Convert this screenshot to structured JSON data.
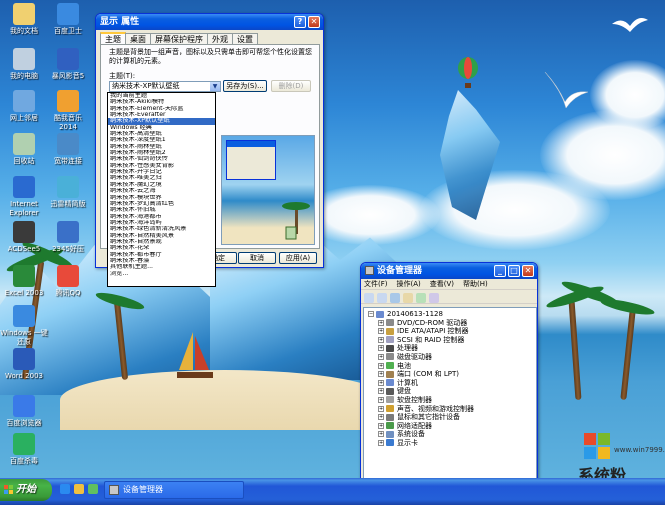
{
  "colors": {
    "xp_blue": "#0054e3",
    "start_green": "#3c9a3c",
    "selection": "#316ac5"
  },
  "desktop_icons": [
    {
      "label": "我的文档",
      "icon": "my-documents-icon"
    },
    {
      "label": "百度卫士",
      "icon": "baidu-guard-icon"
    },
    {
      "label": "我的电脑",
      "icon": "my-computer-icon"
    },
    {
      "label": "暴风影音5",
      "icon": "baofeng-player-icon"
    },
    {
      "label": "网上邻居",
      "icon": "network-places-icon"
    },
    {
      "label": "酷我音乐\n2014",
      "icon": "kuwo-music-icon"
    },
    {
      "label": "回收站",
      "icon": "recycle-bin-icon"
    },
    {
      "label": "宽带连接",
      "icon": "broadband-connection-icon"
    },
    {
      "label": "Internet\nExplorer",
      "icon": "internet-explorer-icon"
    },
    {
      "label": "迅雷精简版",
      "icon": "thunder-icon"
    },
    {
      "label": "ACDSee5",
      "icon": "acdsee-icon"
    },
    {
      "label": "2345好压",
      "icon": "haozip-icon"
    },
    {
      "label": "Excel 2003",
      "icon": "excel-icon"
    },
    {
      "label": "腾讯QQ",
      "icon": "qq-icon"
    },
    {
      "label": "Windows 一键\n还原",
      "icon": "one-key-restore-icon"
    },
    {
      "label": "Word 2003",
      "icon": "word-icon"
    },
    {
      "label": "百度浏览器",
      "icon": "baidu-browser-icon"
    },
    {
      "label": "百度杀毒",
      "icon": "baidu-antivirus-icon"
    }
  ],
  "display_properties": {
    "title": "显示 属性",
    "tabs": [
      "主题",
      "桌面",
      "屏幕保护程序",
      "外观",
      "设置"
    ],
    "description": "主题是背景加一组声音，图标以及只需单击即可帮您个性化设置您的计算机的元素。",
    "theme_label": "主题(T):",
    "theme_selected": "纳米技术-XP默认壁纸",
    "save_as": "另存为(S)...",
    "delete": "删除(D)",
    "ok": "确定",
    "cancel": "取消",
    "apply": "应用(A)",
    "options": [
      "我的当前主题",
      "纳米技术-Akiki模特",
      "纳米技术-Element-天际蓝",
      "纳米技术-Everafter",
      "纳米技术-XP默认壁纸",
      "Windows 经典",
      "纳米技术-高清壁纸",
      "纳米技术-深度壁纸1",
      "纳米技术-雨林壁纸",
      "纳米技术-雨林壁纸2",
      "纳米技术-仙剑奇侠传",
      "纳米技术-性感美女背影",
      "纳米技术-开学日记",
      "纳米技术-唯美之归",
      "纳米技术-魔幻之境",
      "纳米技术-云之海",
      "纳米技术-模块世界",
      "纳米技术-梦幻高清红色",
      "纳米技术-怀旧城",
      "纳米技术-海港都市",
      "纳米技术-海洋岛屿",
      "纳米技术-绿色清新清洗风景",
      "纳米技术-自然精美风景",
      "纳米技术-自然景观",
      "纳米技术-花朵",
      "纳米技术-都市春厅",
      "纳米技术-春藻",
      "其他联机主题...",
      "浏览..."
    ],
    "selected_index": 4
  },
  "device_manager": {
    "title": "设备管理器",
    "menus": [
      "文件(F)",
      "操作(A)",
      "查看(V)",
      "帮助(H)"
    ],
    "root": "20140613-1128",
    "nodes": [
      "DVD/CD-ROM 驱动器",
      "IDE ATA/ATAPI 控制器",
      "SCSI 和 RAID 控制器",
      "处理器",
      "磁盘驱动器",
      "电池",
      "端口 (COM 和 LPT)",
      "计算机",
      "键盘",
      "软盘控制器",
      "声音、视频和游戏控制器",
      "鼠标和其它指针设备",
      "网络适配器",
      "系统设备",
      "显示卡"
    ]
  },
  "taskbar": {
    "start": "开始",
    "task_button": "设备管理器"
  },
  "watermark": {
    "brand": "系统粉",
    "url": "www.win7999.com"
  }
}
